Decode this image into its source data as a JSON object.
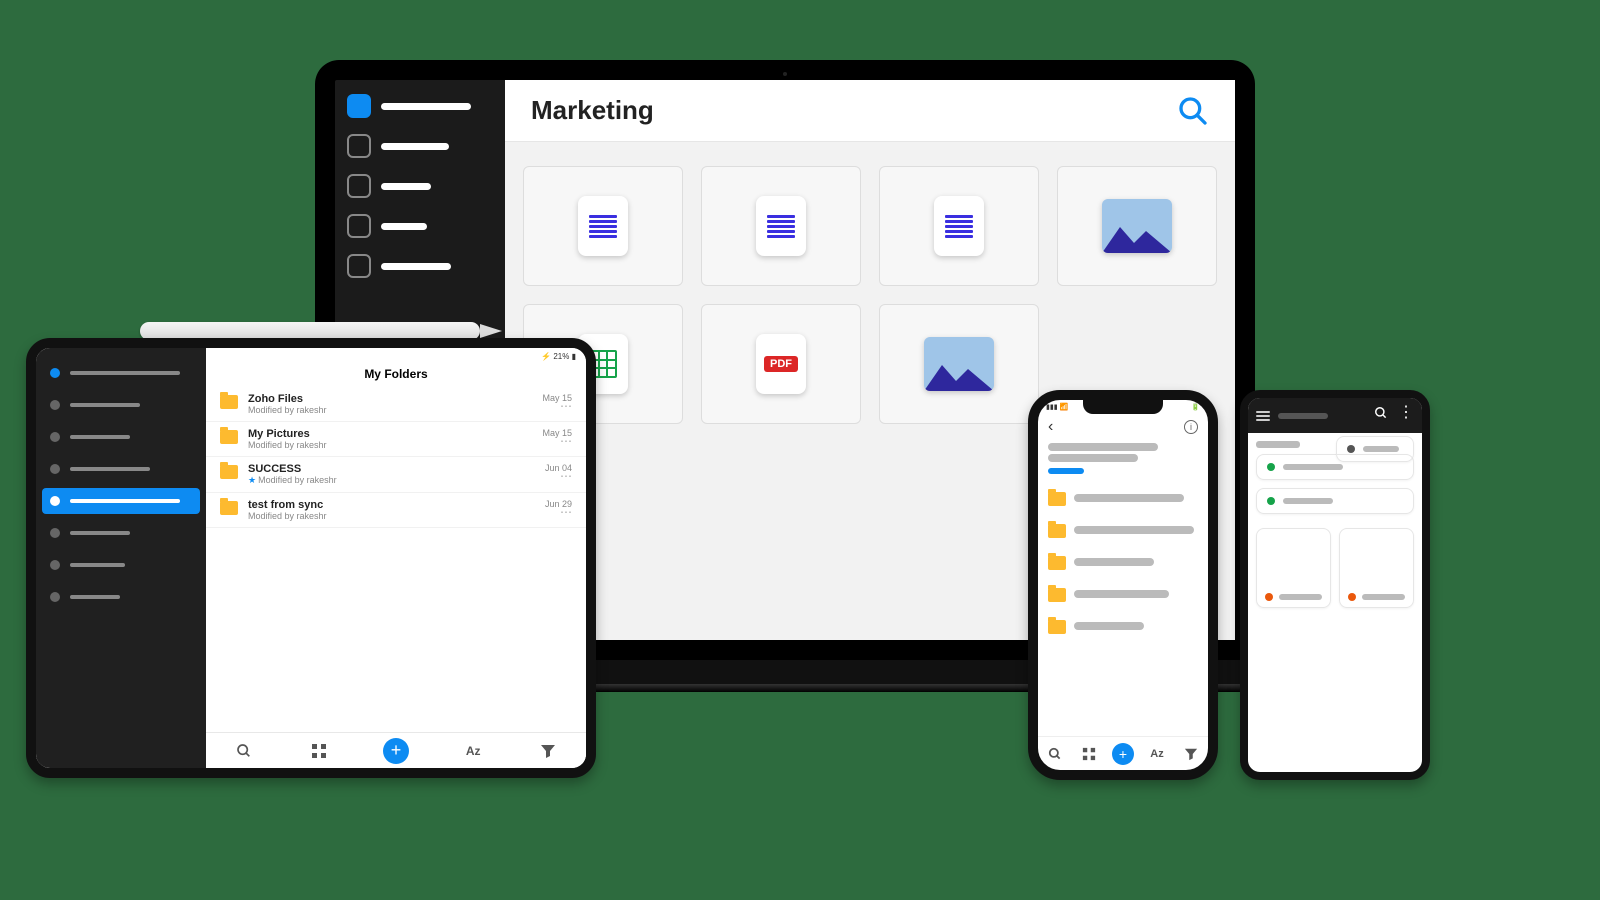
{
  "laptop": {
    "title": "Marketing",
    "files": [
      {
        "type": "doc"
      },
      {
        "type": "doc"
      },
      {
        "type": "doc"
      },
      {
        "type": "image"
      },
      {
        "type": "sheet"
      },
      {
        "type": "pdf",
        "label": "PDF"
      },
      {
        "type": "image"
      }
    ]
  },
  "tablet": {
    "status_battery": "21%",
    "heading": "My Folders",
    "folders": [
      {
        "name": "Zoho Files",
        "meta": "Modified by rakeshr",
        "date": "May 15",
        "starred": false
      },
      {
        "name": "My Pictures",
        "meta": "Modified by rakeshr",
        "date": "May 15",
        "starred": false
      },
      {
        "name": "SUCCESS",
        "meta": "Modified by rakeshr",
        "date": "Jun 04",
        "starred": true
      },
      {
        "name": "test from sync",
        "meta": "Modified by rakeshr",
        "date": "Jun 29",
        "starred": false
      }
    ],
    "sort_label": "Az"
  },
  "phone1": {
    "sort_label": "Az"
  }
}
